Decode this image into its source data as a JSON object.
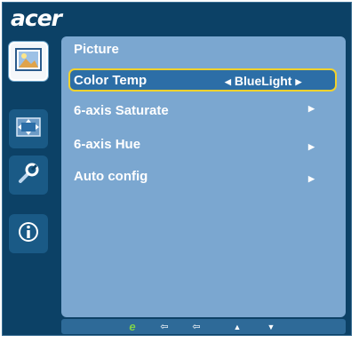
{
  "brand": {
    "logo_text": "acer"
  },
  "sidebar": {
    "items": [
      {
        "name": "picture",
        "icon": "picture-icon",
        "active": true
      },
      {
        "name": "display",
        "icon": "display-position-icon",
        "active": false
      },
      {
        "name": "settings",
        "icon": "wrench-settings-icon",
        "active": false
      },
      {
        "name": "information",
        "icon": "info-icon",
        "active": false
      }
    ]
  },
  "panel": {
    "title": "Picture",
    "items": [
      {
        "label": "Color Temp",
        "value": "BlueLight",
        "left_arrow": "◀",
        "right_arrow": "▶",
        "selected": true
      },
      {
        "label": "6-axis Saturate",
        "arrow": "▶"
      },
      {
        "label": "6-axis Hue",
        "arrow": "▶"
      },
      {
        "label": "Auto config",
        "arrow": "▶"
      }
    ]
  },
  "bottom_bar": {
    "buttons": [
      {
        "icon": "e-logo-icon",
        "glyph": "e"
      },
      {
        "icon": "input-icon",
        "glyph": "⇦"
      },
      {
        "icon": "enter-icon",
        "glyph": "⇦"
      },
      {
        "icon": "up-icon",
        "glyph": "▲"
      },
      {
        "icon": "down-icon",
        "glyph": "▼"
      }
    ]
  },
  "colors": {
    "osd_background": "#0c4166",
    "panel_background": "#7ba7d0",
    "highlight": "#f2d22c"
  }
}
